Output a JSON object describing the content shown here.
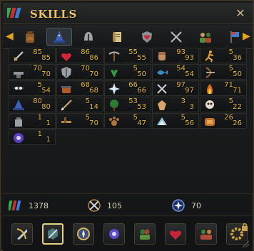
{
  "window": {
    "title": "SKILLS"
  },
  "tabs": [
    {
      "icon": "backpack-icon"
    },
    {
      "icon": "wizard-hat-icon",
      "active": true
    },
    {
      "icon": "helmet-icon"
    },
    {
      "icon": "scroll-icon"
    },
    {
      "icon": "heart-shield-icon"
    },
    {
      "icon": "crossed-swords-icon"
    },
    {
      "icon": "group-icon"
    },
    {
      "icon": "flag-icon"
    }
  ],
  "skills": [
    {
      "icon": "attack-icon",
      "level": "85",
      "base": "85"
    },
    {
      "icon": "constitution-icon",
      "level": "86",
      "base": "86"
    },
    {
      "icon": "mining-icon",
      "level": "55",
      "base": "55"
    },
    {
      "icon": "strength-icon",
      "level": "93",
      "base": "93"
    },
    {
      "icon": "agility-icon",
      "level": "5",
      "base": "36"
    },
    {
      "icon": "smithing-icon",
      "level": "70",
      "base": "70"
    },
    {
      "icon": "defence-icon",
      "level": "70",
      "base": "70"
    },
    {
      "icon": "herblore-icon",
      "level": "5",
      "base": "50"
    },
    {
      "icon": "fishing-icon",
      "level": "54",
      "base": "54"
    },
    {
      "icon": "ranged-icon",
      "level": "5",
      "base": "50"
    },
    {
      "icon": "thieving-icon",
      "level": "5",
      "base": "54"
    },
    {
      "icon": "cooking-icon",
      "level": "68",
      "base": "68"
    },
    {
      "icon": "prayer-icon",
      "level": "66",
      "base": "66"
    },
    {
      "icon": "crafting-icon",
      "level": "97",
      "base": "97"
    },
    {
      "icon": "firemaking-icon",
      "level": "71",
      "base": "71"
    },
    {
      "icon": "magic-icon",
      "level": "80",
      "base": "80"
    },
    {
      "icon": "fletching-icon",
      "level": "5",
      "base": "14"
    },
    {
      "icon": "woodcutting-icon",
      "level": "53",
      "base": "53"
    },
    {
      "icon": "runecrafting-icon",
      "level": "3",
      "base": "3"
    },
    {
      "icon": "slayer-icon",
      "level": "5",
      "base": "22"
    },
    {
      "icon": "farming-icon",
      "level": "1",
      "base": "1"
    },
    {
      "icon": "construction-icon",
      "level": "5",
      "base": "70"
    },
    {
      "icon": "hunter-icon",
      "level": "5",
      "base": "47"
    },
    {
      "icon": "summoning-icon",
      "level": "5",
      "base": "56"
    },
    {
      "icon": "dungeoneering-icon",
      "level": "26",
      "base": "26"
    },
    {
      "icon": "divination-icon",
      "level": "1",
      "base": "1"
    }
  ],
  "stats": {
    "total_level": "1378",
    "combat_level": "105",
    "prayer_points": "70"
  },
  "ribbon": [
    {
      "icon": "combat-icon"
    },
    {
      "icon": "skills-icon",
      "active": true
    },
    {
      "icon": "compass-icon"
    },
    {
      "icon": "powers-icon"
    },
    {
      "icon": "friends-icon"
    },
    {
      "icon": "heart-icon"
    },
    {
      "icon": "social-icon"
    },
    {
      "icon": "settings-gear-icon"
    }
  ],
  "colors": {
    "level": "#e4b83f",
    "title": "#e9c46a",
    "accent_arrow": "#e0a21c"
  }
}
